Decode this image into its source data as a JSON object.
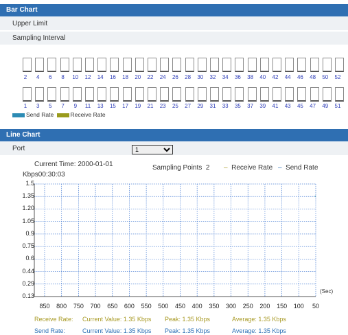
{
  "bar_chart": {
    "header": "Bar Chart",
    "upper_limit_label": "Upper Limit",
    "sampling_interval_label": "Sampling Interval",
    "even_ticks": [
      "2",
      "4",
      "6",
      "8",
      "10",
      "12",
      "14",
      "16",
      "18",
      "20",
      "22",
      "24",
      "26",
      "28",
      "30",
      "32",
      "34",
      "36",
      "38",
      "40",
      "42",
      "44",
      "46",
      "48",
      "50",
      "52"
    ],
    "odd_ticks": [
      "1",
      "3",
      "5",
      "7",
      "9",
      "11",
      "13",
      "15",
      "17",
      "19",
      "21",
      "23",
      "25",
      "27",
      "29",
      "31",
      "33",
      "35",
      "37",
      "39",
      "41",
      "43",
      "45",
      "47",
      "49",
      "51"
    ],
    "legend": {
      "send_rate": "Send Rate",
      "receive_rate": "Receive Rate"
    },
    "colors": {
      "send_rate": "#2c8bb4",
      "receive_rate": "#9a9b1c"
    }
  },
  "line_chart": {
    "header": "Line Chart",
    "port_label": "Port",
    "port_value": "1",
    "current_time_label": "Current Time: 2000-01-01",
    "time_value": "00:30:03",
    "unit_label": "Kbps",
    "sampling_points_label": "Sampling Points",
    "sampling_points_value": "2",
    "legend_receive": "Receive Rate",
    "legend_send": "Send Rate",
    "x_unit": "(Sec)",
    "receive_row": {
      "label": "Receive Rate:",
      "current": "Current Value: 1.35 Kbps",
      "peak": "Peak: 1.35 Kbps",
      "average": "Average: 1.35 Kbps"
    },
    "send_row": {
      "label": "Send Rate:",
      "current": "Current Value: 1.35 Kbps",
      "peak": "Peak: 1.35 Kbps",
      "average": "Average: 1.35 Kbps"
    },
    "colors": {
      "receive": "#b5a93a",
      "send": "#2a8fb8",
      "grid": "#4a7fd4"
    }
  },
  "chart_data": {
    "type": "line",
    "ylabel": "Kbps",
    "xlabel": "(Sec)",
    "yticks": [
      "1.5",
      "1.35",
      "1.20",
      "1.05",
      "0.9",
      "0.75",
      "0.6",
      "0.44",
      "0.29",
      "0.13"
    ],
    "xticks": [
      "850",
      "800",
      "750",
      "700",
      "650",
      "600",
      "550",
      "500",
      "450",
      "400",
      "350",
      "300",
      "250",
      "200",
      "150",
      "100",
      "50"
    ],
    "ylim": [
      0.13,
      1.5
    ],
    "xlim": [
      850,
      0
    ],
    "series": [
      {
        "name": "Receive Rate",
        "x": [
          2,
          1
        ],
        "values": [
          1.35,
          1.35
        ]
      },
      {
        "name": "Send Rate",
        "x": [
          2,
          1
        ],
        "values": [
          1.35,
          1.35
        ]
      }
    ]
  }
}
